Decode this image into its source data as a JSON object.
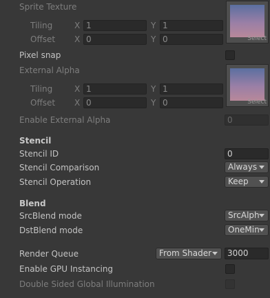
{
  "sprite_texture": {
    "label": "Sprite Texture",
    "tiling_label": "Tiling",
    "offset_label": "Offset",
    "x_label": "X",
    "y_label": "Y",
    "tiling_x": "1",
    "tiling_y": "1",
    "offset_x": "0",
    "offset_y": "0",
    "select_label": "Select"
  },
  "pixel_snap": {
    "label": "Pixel snap"
  },
  "external_alpha": {
    "label": "External Alpha",
    "tiling_label": "Tiling",
    "offset_label": "Offset",
    "x_label": "X",
    "y_label": "Y",
    "tiling_x": "1",
    "tiling_y": "1",
    "offset_x": "0",
    "offset_y": "0",
    "select_label": "Select"
  },
  "enable_external_alpha": {
    "label": "Enable External Alpha",
    "value": "0"
  },
  "stencil": {
    "header": "Stencil",
    "id_label": "Stencil ID",
    "id_value": "0",
    "comparison_label": "Stencil Comparison",
    "comparison_value": "Always",
    "operation_label": "Stencil Operation",
    "operation_value": "Keep"
  },
  "blend": {
    "header": "Blend",
    "src_label": "SrcBlend mode",
    "src_value": "SrcAlph",
    "dst_label": "DstBlend mode",
    "dst_value": "OneMin"
  },
  "render_queue": {
    "label": "Render Queue",
    "mode": "From Shader",
    "value": "3000"
  },
  "gpu_instancing": {
    "label": "Enable GPU Instancing"
  },
  "double_sided_gi": {
    "label": "Double Sided Global Illumination"
  }
}
